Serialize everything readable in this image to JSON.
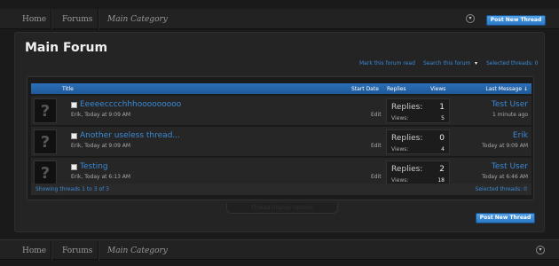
{
  "nav": {
    "items": [
      "Home",
      "Forums",
      "Main Category"
    ],
    "jump_icon": "chevron-down-icon"
  },
  "buttons": {
    "post_new_thread": "Post New Thread"
  },
  "page": {
    "title": "Main Forum",
    "links": {
      "mark_read": "Mark this forum read",
      "search": "Search this forum",
      "selected_threads": "Selected threads: 0"
    }
  },
  "table": {
    "headers": {
      "title": "Title",
      "start_date": "Start Date",
      "replies": "Replies",
      "views": "Views",
      "last_message": "Last Message ↓"
    },
    "rows": [
      {
        "title": "Eeeeecccchhhooooooooo",
        "meta": "Erik, Today at 9:09 AM",
        "edit": "Edit",
        "replies_label": "Replies:",
        "replies": "1",
        "views_label": "Views:",
        "views": "5",
        "last_user": "Test User",
        "last_time": "1 minute ago"
      },
      {
        "title": "Another useless thread...",
        "meta": "Erik, Today at 9:09 AM",
        "edit": "Edit",
        "replies_label": "Replies:",
        "replies": "0",
        "views_label": "Views:",
        "views": "4",
        "last_user": "Erik",
        "last_time": "Today at 9:09 AM"
      },
      {
        "title": "Testing",
        "meta": "Erik, Today at 6:13 AM",
        "edit": "Edit",
        "replies_label": "Replies:",
        "replies": "2",
        "views_label": "Views:",
        "views": "18",
        "last_user": "Test User",
        "last_time": "Today at 6:46 AM"
      }
    ],
    "footer": {
      "showing": "Showing threads 1 to 3 of 3",
      "selected": "Selected threads: 0"
    },
    "options_tab": "Thread Display Options"
  },
  "colors": {
    "accent": "#3a8ad6",
    "header_bar": "#2b6fb8",
    "background": "#1a1a1a"
  }
}
